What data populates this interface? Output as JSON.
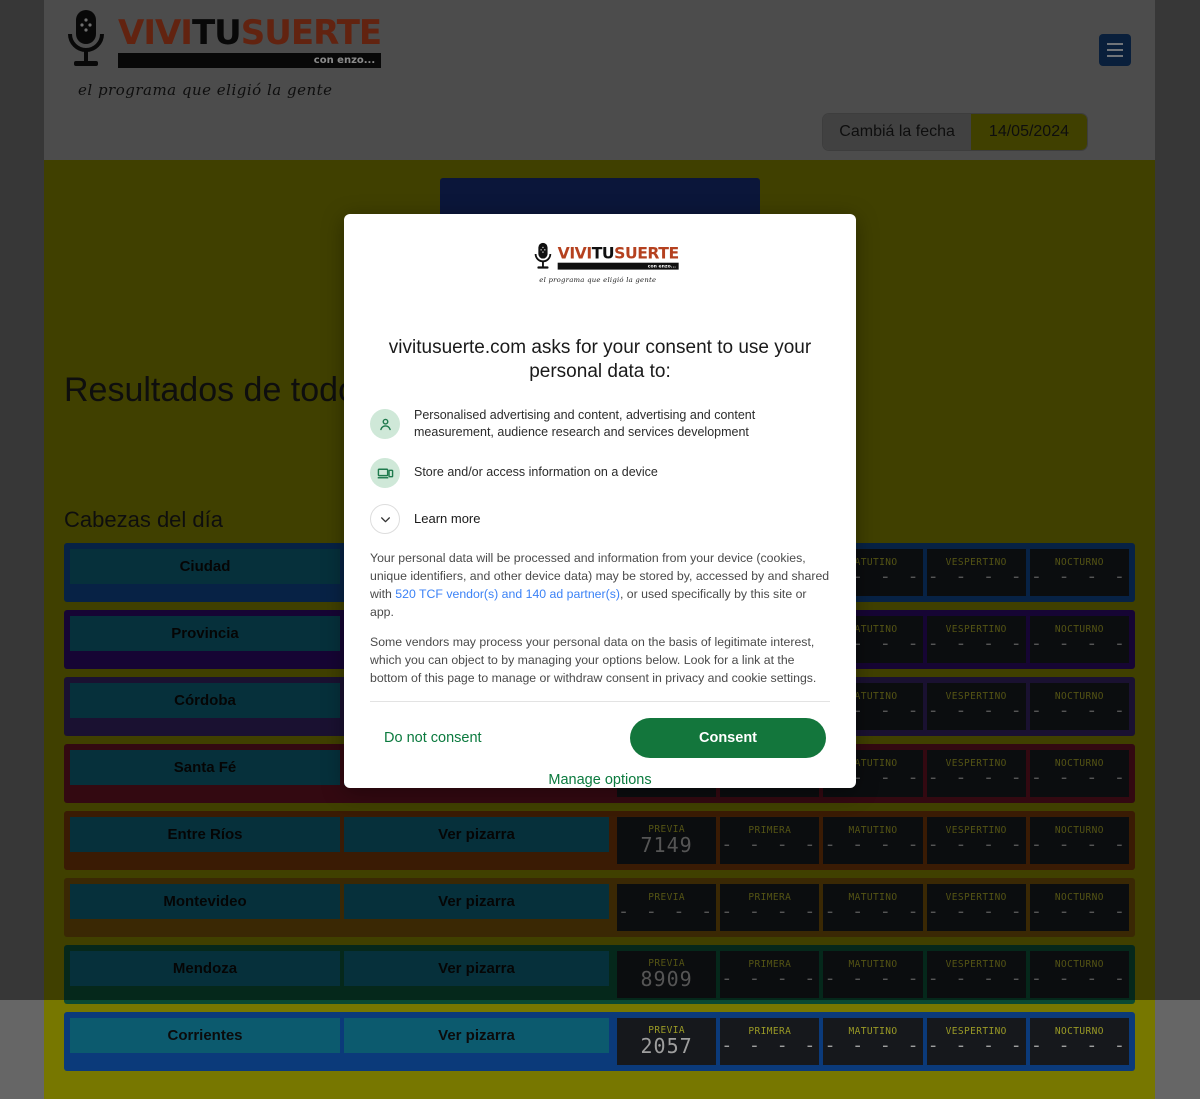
{
  "site": {
    "logo": {
      "part1": "VIVI",
      "part2": "TU",
      "part3": "SUERTE",
      "sub": "con enzo...",
      "tagline": "el programa que eligió la gente"
    },
    "menu_icon": "hamburger-icon"
  },
  "datebar": {
    "label": "Cambiá la fecha",
    "value": "14/05/2024"
  },
  "main": {
    "page_title": "Resultados de todo el",
    "section_title": "Cabezas del día",
    "draw_columns": [
      "PREVIA",
      "PRIMERA",
      "MATUTINO",
      "VESPERTINO",
      "NOCTURNO"
    ],
    "board_label": "Ver pizarra",
    "empty_value": "- - - -",
    "rows": [
      {
        "name": "Ciudad",
        "band": "#0d3f80",
        "values": [
          "",
          "",
          "",
          "",
          ""
        ]
      },
      {
        "name": "Provincia",
        "band": "#2a0a60",
        "values": [
          "",
          "",
          "",
          "",
          ""
        ]
      },
      {
        "name": "Córdoba",
        "band": "#30205c",
        "values": [
          "",
          "",
          "",
          "",
          ""
        ]
      },
      {
        "name": "Santa Fé",
        "band": "#5e1220",
        "values": [
          "",
          "",
          "",
          "",
          ""
        ]
      },
      {
        "name": "Entre Ríos",
        "band": "#6b3208",
        "values": [
          "7149",
          "",
          "",
          "",
          ""
        ]
      },
      {
        "name": "Montevideo",
        "band": "#6b4a08",
        "values": [
          "",
          "",
          "",
          "",
          ""
        ]
      },
      {
        "name": "Mendoza",
        "band": "#0b4a32",
        "values": [
          "8909",
          "",
          "",
          "",
          ""
        ]
      },
      {
        "name": "Corrientes",
        "band": "#0b3a7a",
        "values": [
          "2057",
          "",
          "",
          "",
          ""
        ]
      }
    ]
  },
  "consent": {
    "headline": "vivitusuerte.com asks for your consent to use your personal data to:",
    "purposes": [
      {
        "icon": "person-icon",
        "text": "Personalised advertising and content, advertising and content measurement, audience research and services development"
      },
      {
        "icon": "device-icon",
        "text": "Store and/or access information on a device"
      }
    ],
    "learn_more": "Learn more",
    "paragraph1_before": "Your personal data will be processed and information from your device (cookies, unique identifiers, and other device data) may be stored by, accessed by and shared with ",
    "paragraph1_link": "520 TCF vendor(s) and 140 ad partner(s)",
    "paragraph1_after": ", or used specifically by this site or app.",
    "paragraph2": "Some vendors may process your personal data on the basis of legitimate interest, which you can object to by managing your options below. Look for a link at the bottom of this page to manage or withdraw consent in privacy and cookie settings.",
    "do_not_consent": "Do not consent",
    "consent": "Consent",
    "manage_options": "Manage options",
    "accent_color": "#13763c",
    "link_color": "#3b82f6"
  }
}
